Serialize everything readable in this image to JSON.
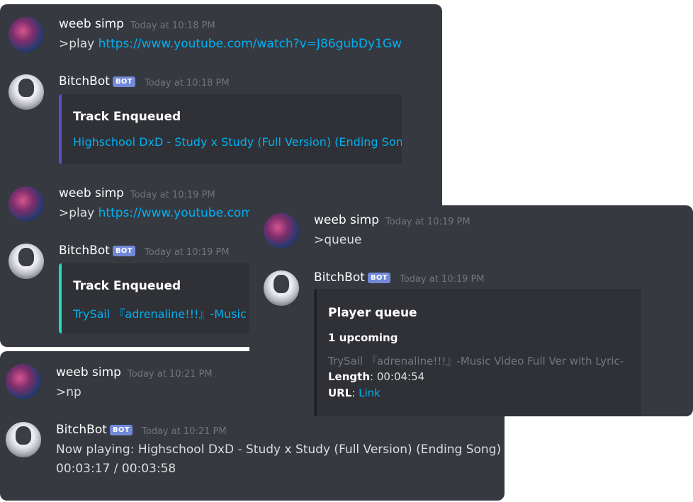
{
  "colors": {
    "background": "#36393f",
    "embed_bg": "#2f3136",
    "link": "#00b0f4",
    "bot_tag": "#7289da",
    "embed_bar_1": "#5c4fc4",
    "embed_bar_2": "#1fd8c7",
    "embed_bar_3": "#202225"
  },
  "icons": {
    "user_avatar": "weeb-simp-avatar",
    "bot_avatar": "bitchbot-avatar"
  },
  "panel1": {
    "msg1": {
      "user": "weeb simp",
      "time": "Today at 10:18 PM",
      "prefix": ">play ",
      "link": "https://www.youtube.com/watch?v=J86gubDy1Gw"
    },
    "msg2": {
      "user": "BitchBot",
      "tag": "BOT",
      "time": "Today at 10:18 PM",
      "embed_title": "Track Enqueued",
      "embed_desc": "Highschool DxD - Study x Study (Full Version) (Ending Song)"
    },
    "msg3": {
      "user": "weeb simp",
      "time": "Today at 10:19 PM",
      "prefix": ">play ",
      "link": "https://www.youtube.com/"
    },
    "msg4": {
      "user": "BitchBot",
      "tag": "BOT",
      "time": "Today at 10:19 PM",
      "embed_title": "Track Enqueued",
      "embed_desc": "TrySail 『adrenaline!!!』-Music V"
    }
  },
  "panel2": {
    "msg1": {
      "user": "weeb simp",
      "time": "Today at 10:19 PM",
      "text": ">queue"
    },
    "msg2": {
      "user": "BitchBot",
      "tag": "BOT",
      "time": "Today at 10:19 PM",
      "embed_title": "Player queue",
      "upcoming": "1 upcoming",
      "track": "TrySail 『adrenaline!!!』-Music Video Full Ver with Lyric-",
      "length_label": "Length",
      "length_value": ": 00:04:54",
      "url_label": "URL",
      "url_sep": ": ",
      "url_link": "Link"
    }
  },
  "panel3": {
    "msg1": {
      "user": "weeb simp",
      "time": "Today at 10:21 PM",
      "text": ">np"
    },
    "msg2": {
      "user": "BitchBot",
      "tag": "BOT",
      "time": "Today at 10:21 PM",
      "line1": "Now playing: Highschool DxD - Study x Study (Full Version) (Ending Song)",
      "line2": "00:03:17 / 00:03:58"
    }
  }
}
